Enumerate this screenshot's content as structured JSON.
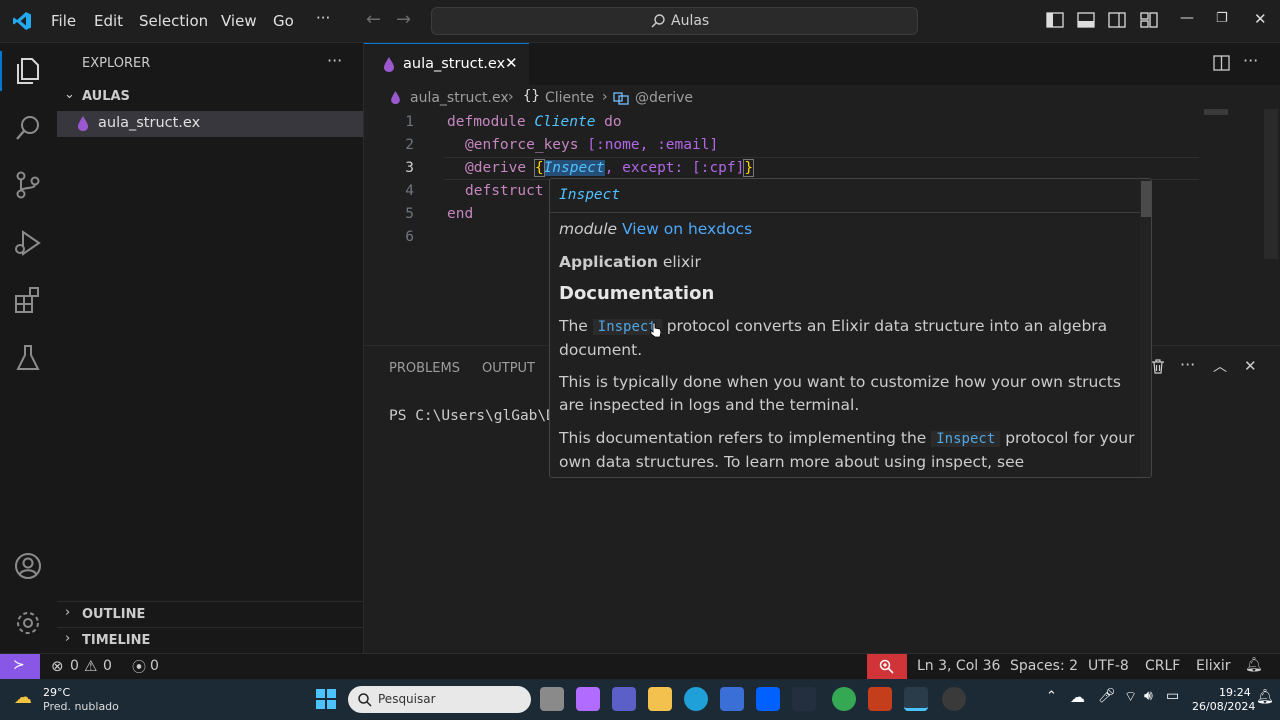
{
  "titlebar": {
    "menus": [
      "File",
      "Edit",
      "Selection",
      "View",
      "Go"
    ],
    "more": "···",
    "search_text": "Aulas"
  },
  "sidebar": {
    "header": "EXPLORER",
    "more": "···",
    "folder": "AULAS",
    "file": "aula_struct.ex",
    "outline": "OUTLINE",
    "timeline": "TIMELINE"
  },
  "editor": {
    "tab": "aula_struct.ex",
    "breadcrumb": [
      "aula_struct.ex",
      "Cliente",
      "@derive"
    ],
    "lines": [
      "1",
      "2",
      "3",
      "4",
      "5",
      "6"
    ],
    "code": {
      "l1_kw": "defmodule",
      "l1_mod": "Cliente",
      "l1_do": "do",
      "l2_attr": "@enforce_keys",
      "l2_val": "[:nome, :email]",
      "l3_attr": "@derive",
      "l3_open": "{",
      "l3_mod": "Inspect",
      "l3_rest": ", except: [:cpf]",
      "l3_close": "}",
      "l4_kw": "defstruct",
      "l5_end": "end"
    }
  },
  "hover": {
    "title": "Inspect",
    "module_label": "module",
    "hexdocs_link": "View on hexdocs",
    "app_label": "Application",
    "app_value": "elixir",
    "doc_heading": "Documentation",
    "p1_a": "The",
    "p1_code": "Inspect",
    "p1_b": "protocol converts an Elixir data structure into an algebra document.",
    "p2": "This is typically done when you want to customize how your own structs are inspected in logs and the terminal.",
    "p3_a": "This documentation refers to implementing the",
    "p3_code": "Inspect",
    "p3_b": "protocol for your own data structures. To learn more about using inspect, see"
  },
  "panel": {
    "tabs": [
      "PROBLEMS",
      "OUTPUT"
    ],
    "terminal_text": "PS C:\\Users\\glGab\\D"
  },
  "status": {
    "errors": "0",
    "warnings": "0",
    "ports": "0",
    "position": "Ln 3, Col 36",
    "spaces": "Spaces: 2",
    "encoding": "UTF-8",
    "eol": "CRLF",
    "language": "Elixir"
  },
  "taskbar": {
    "weather_temp": "29°C",
    "weather_desc": "Pred. nublado",
    "search_placeholder": "Pesquisar",
    "time": "19:24",
    "date": "26/08/2024"
  },
  "colors": {
    "accent": "#0078d4",
    "remote": "#8957e5",
    "zoom_badge": "#d13438"
  }
}
